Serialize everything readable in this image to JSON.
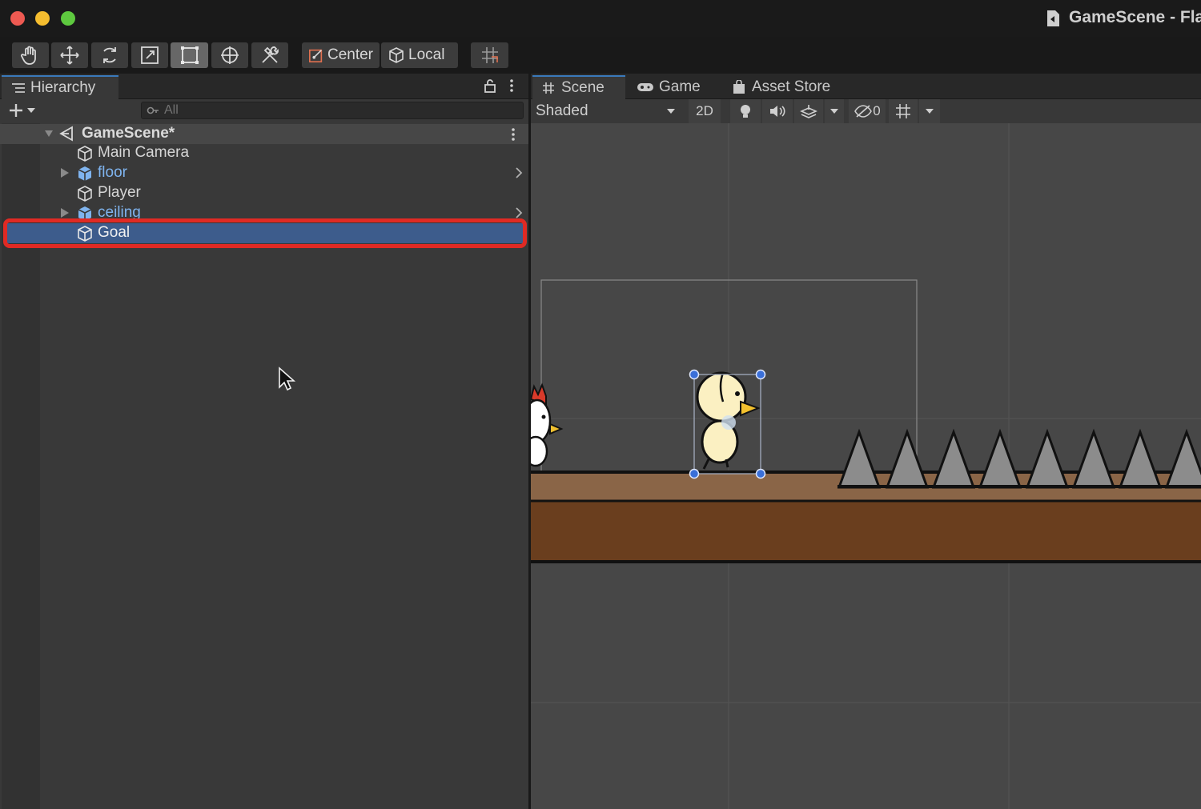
{
  "window": {
    "title": "GameScene - Fla",
    "traffic_lights": {
      "close": "#ee5a52",
      "minimize": "#f5bd2f",
      "zoom": "#5ec93f"
    }
  },
  "toolbar": {
    "tools": [
      "hand-icon",
      "move-icon",
      "rotate-icon",
      "scale-icon",
      "rect-icon",
      "transform-icon",
      "custom-tools-icon"
    ],
    "active_tool": "rect-icon",
    "pivot_mode_label": "Center",
    "pivot_rotation_label": "Local",
    "snap_icon": "grid-snap-icon"
  },
  "hierarchy": {
    "tab_label": "Hierarchy",
    "search_placeholder": "All",
    "scene": {
      "name": "GameScene*"
    },
    "items": [
      {
        "name": "Main Camera",
        "prefab": false,
        "expandable": false
      },
      {
        "name": "floor",
        "prefab": true,
        "expandable": true
      },
      {
        "name": "Player",
        "prefab": false,
        "expandable": false
      },
      {
        "name": "ceiling",
        "prefab": true,
        "expandable": true
      },
      {
        "name": "Goal",
        "prefab": false,
        "expandable": false,
        "selected": true
      }
    ],
    "highlight_color": "#e02a24",
    "selection_color": "#3d5c8c"
  },
  "scene_view": {
    "tabs": [
      "Scene",
      "Game",
      "Asset Store"
    ],
    "active_tab": "Scene",
    "shading_mode": "Shaded",
    "mode_2d_label": "2D",
    "hidden_count": "0",
    "colors": {
      "background": "#474747",
      "floor_top": "#8a6547",
      "floor_body": "#6a3e1e",
      "spike": "#8c8c8c",
      "gizmo": "#3a6fd8"
    }
  }
}
